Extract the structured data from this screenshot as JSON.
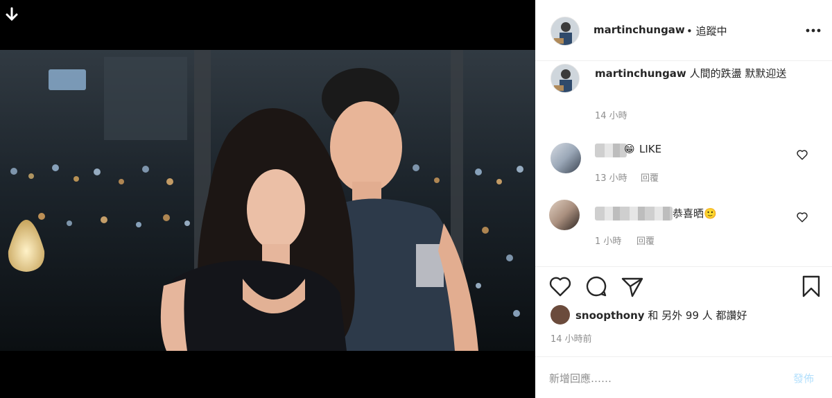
{
  "post": {
    "username": "martinchungaw",
    "follow_status": "• 追蹤中",
    "caption_user": "martinchungaw",
    "caption_text": "人間的跌盪  默默迎送",
    "caption_time": "14 小時"
  },
  "comments": [
    {
      "text": "LIKE",
      "time": "13 小時",
      "reply": "回覆"
    },
    {
      "text": "恭喜晒🙂",
      "time": "1 小時",
      "reply": "回覆"
    }
  ],
  "actions": {
    "icons": [
      "heart-icon",
      "comment-icon",
      "share-icon",
      "bookmark-icon"
    ]
  },
  "likes": {
    "first_user": "snoopthony",
    "rest": "和 另外 99 人 都讚好"
  },
  "posted_time": "14 小時前",
  "add_comment": {
    "placeholder": "新增回應……",
    "post_label": "發佈"
  },
  "colors": {
    "accent": "#b2dffc",
    "text": "#262626",
    "muted": "#8e8e8e",
    "divider": "#efefef"
  }
}
